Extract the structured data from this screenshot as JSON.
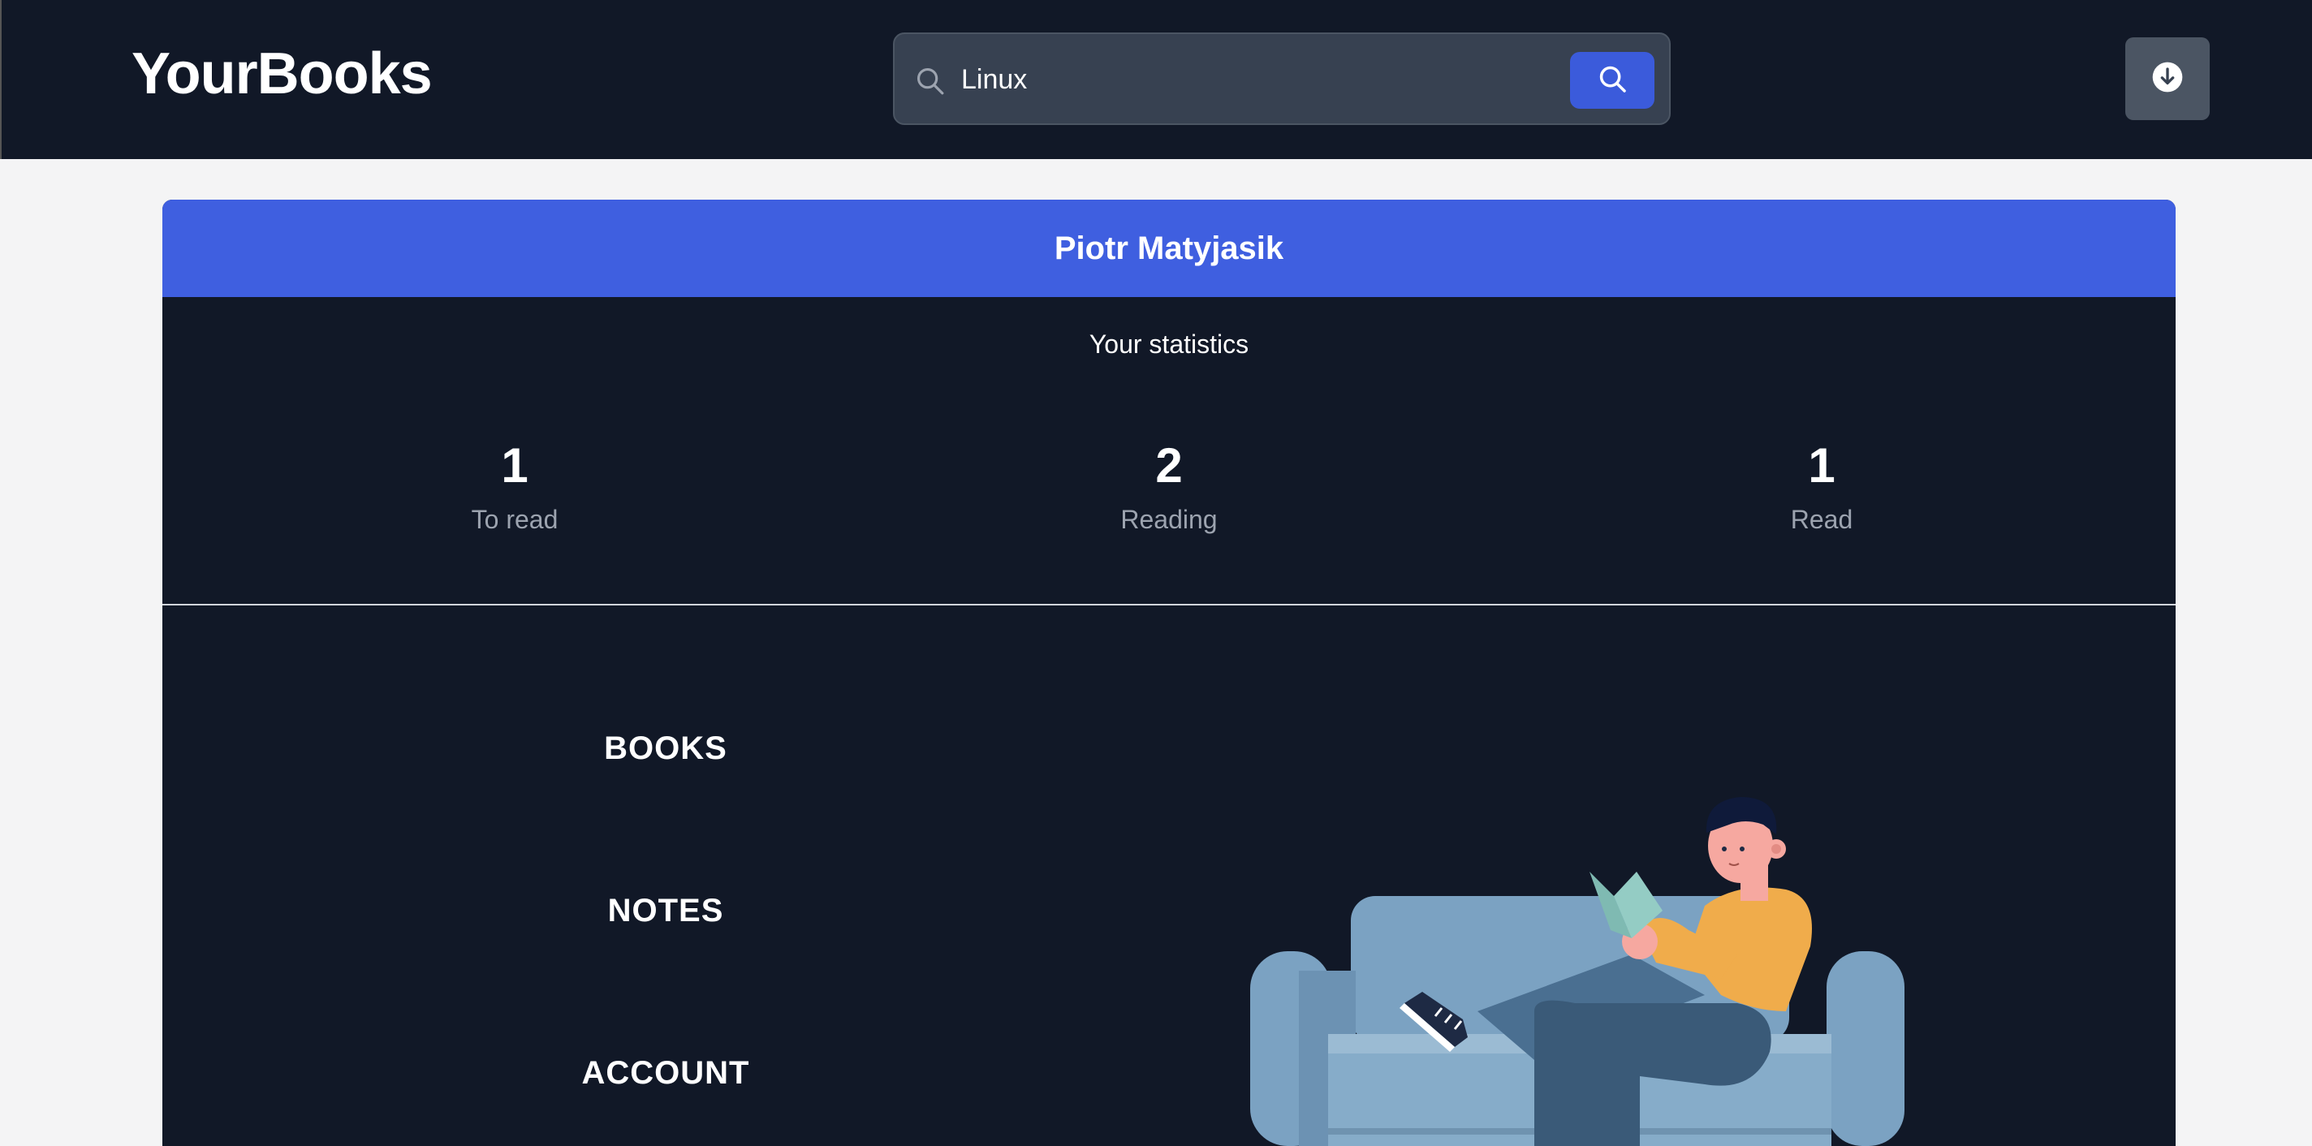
{
  "header": {
    "logo": "YourBooks",
    "search": {
      "value": "Linux",
      "placeholder": "Search",
      "icon": "search-icon",
      "button_icon": "search-icon"
    },
    "download_icon": "arrow-down-circle-icon"
  },
  "profile": {
    "name": "Piotr Matyjasik",
    "stats_title": "Your statistics",
    "stats": [
      {
        "value": "1",
        "label": "To read"
      },
      {
        "value": "2",
        "label": "Reading"
      },
      {
        "value": "1",
        "label": "Read"
      }
    ]
  },
  "menu": [
    {
      "label": "BOOKS"
    },
    {
      "label": "NOTES"
    },
    {
      "label": "ACCOUNT"
    }
  ],
  "colors": {
    "header_bg": "#111827",
    "accent": "#3f5fe0",
    "card_bg": "#111827",
    "page_bg": "#f4f4f5"
  }
}
